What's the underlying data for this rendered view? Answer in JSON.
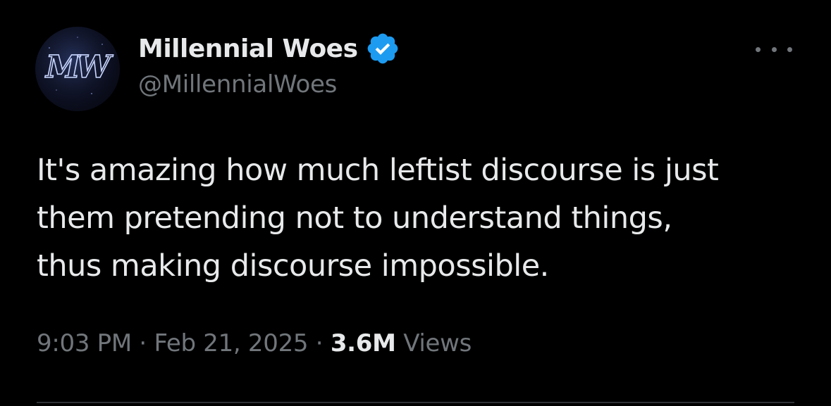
{
  "author": {
    "display_name": "Millennial Woes",
    "handle": "@MillennialWoes",
    "avatar_text": "MW",
    "verified_icon": "verified-badge-icon",
    "verified_color": "#1d9bf0"
  },
  "tweet": {
    "text": "It's amazing how much leftist discourse is just\nthem pretending not to understand things,\nthus making discourse impossible.",
    "time": "9:03 PM",
    "separator": "·",
    "date": "Feb 21, 2025",
    "views_count": "3.6M",
    "views_label": "Views"
  },
  "menu": {
    "icon": "more-options-icon"
  },
  "colors": {
    "background": "#000000",
    "text_primary": "#e7e9ea",
    "text_secondary": "#71767b",
    "divider": "#2f3336"
  }
}
